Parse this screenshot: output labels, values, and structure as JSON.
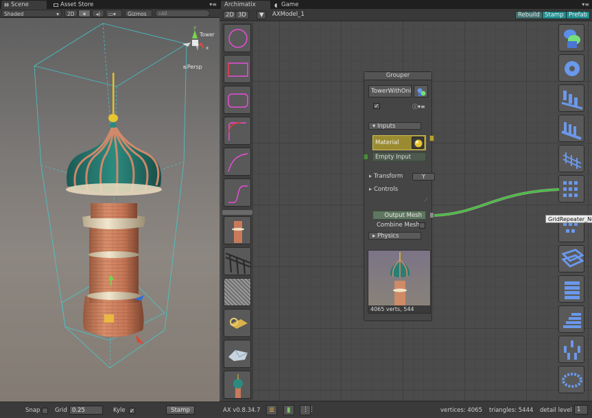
{
  "scene": {
    "tabs": [
      {
        "label": "Scene",
        "icon": "grid-icon"
      },
      {
        "label": "Asset Store",
        "icon": "store-icon"
      }
    ],
    "toolbar": {
      "shading": "Shaded",
      "mode2d": "2D",
      "gizmos": "Gizmos",
      "search_placeholder": "All"
    },
    "gizmo": {
      "object_label": "Tower",
      "projection": "Persp",
      "axes": [
        "x",
        "y",
        "z"
      ]
    },
    "bottom": {
      "snap_label": "Snap",
      "grid_label": "Grid",
      "grid_value": "0.25",
      "kyle_label": "Kyle",
      "kyle_checked": "✓",
      "stamp_label": "Stamp"
    }
  },
  "archimatix": {
    "tabs": [
      {
        "label": "Archimatix",
        "icon": "archimatix-icon"
      },
      {
        "label": "Game",
        "icon": "game-icon"
      }
    ],
    "header": {
      "btn2d": "2D",
      "btn3d": "3D",
      "model_name": "AXModel_1",
      "rebuild": "Rebuild",
      "stamp": "Stamp",
      "prefab": "Prefab"
    },
    "node": {
      "title": "Grouper",
      "name_field": "TowerWithOni",
      "checkbox": "✓",
      "inputs_label": "Inputs",
      "material_label": "Material",
      "empty_input_label": "Empty Input",
      "transform_label": "Transform",
      "transform_axis": "Y",
      "controls_label": "Controls",
      "output_mesh_label": "Output Mesh",
      "combine_label": "Combine Meshe",
      "physics_label": "Physics",
      "stats": "4065 verts, 544"
    },
    "tooltip": "GridRepeater_No",
    "status": {
      "version": "AX v0.8.34.7",
      "vertices": "vertices: 4065",
      "triangles": "triangles: 5444",
      "detail_label": "detail level",
      "detail_value": "1"
    },
    "left_palette": [
      "circle-shape",
      "rectangle-shape",
      "rounded-rect-shape",
      "corner-arc-shape",
      "curve-shape",
      "s-curve-shape",
      "tower-thumb",
      "truss-thumb",
      "texture-thumb",
      "key-thumb",
      "rock-thumb",
      "onion-tower-thumb"
    ],
    "right_palette": [
      "extrude-icon",
      "lathe-icon",
      "repeater-icon",
      "repeater-2-icon",
      "fence-icon",
      "grid-repeater-icon",
      "floor-repeater-icon",
      "grid-frame-icon",
      "stack-icon",
      "stairs-icon",
      "radial-icon",
      "ring-icon"
    ]
  },
  "colors": {
    "accent_teal": "#1f8c8e",
    "material_yellow": "#9a8b31",
    "wire_green": "#6fd86a"
  }
}
